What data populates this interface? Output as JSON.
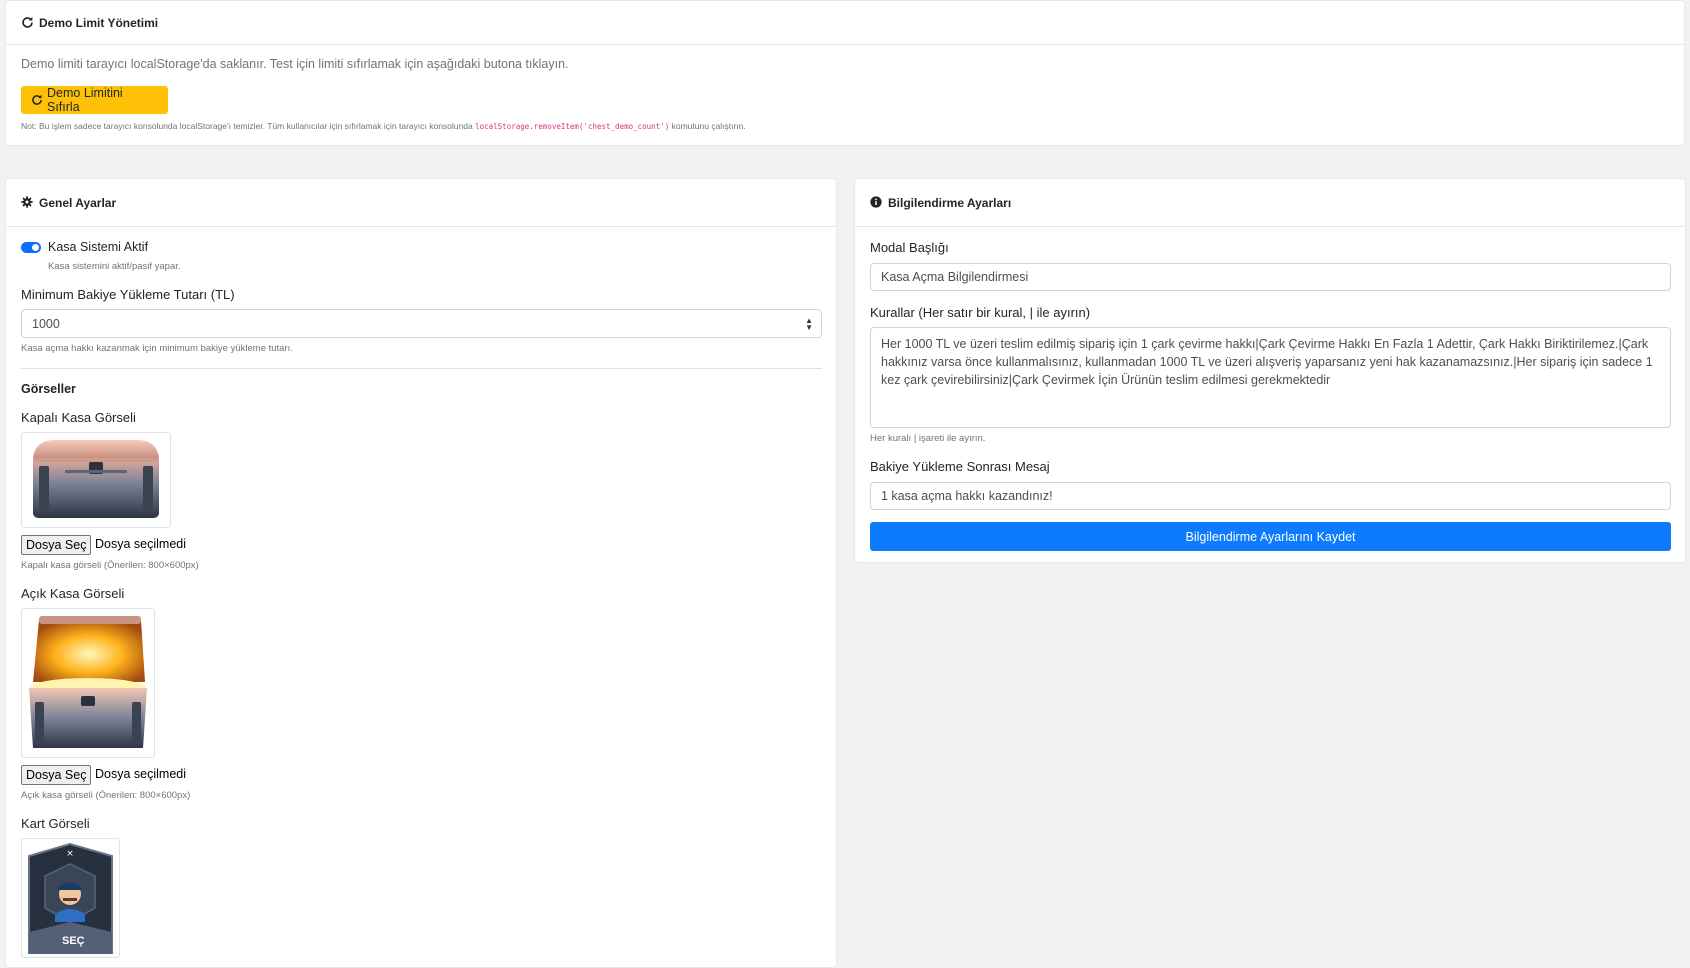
{
  "demo_card": {
    "title": "Demo Limit Yönetimi",
    "description": "Demo limiti tarayıcı localStorage'da saklanır. Test için limiti sıfırlamak için aşağıdaki butona tıklayın.",
    "reset_button": "Demo Limitini Sıfırla",
    "note_prefix": "Not: Bu işlem sadece tarayıcı konsolunda localStorage'ı temizler. Tüm kullanıcılar için sıfırlamak için tarayıcı konsolunda",
    "note_code": "localStorage.removeItem('chest_demo_count')",
    "note_suffix": "komutunu çalıştırın."
  },
  "general_card": {
    "title": "Genel Ayarlar",
    "toggle_label": "Kasa Sistemi Aktif",
    "toggle_on": true,
    "toggle_help": "Kasa sistemini aktif/pasif yapar.",
    "min_amount_label": "Minimum Bakiye Yükleme Tutarı (TL)",
    "min_amount_value": "1000",
    "min_amount_help": "Kasa açma hakkı kazanmak için minimum bakiye yükleme tutarı.",
    "images_heading": "Görseller",
    "closed_image_label": "Kapalı Kasa Görseli",
    "closed_image_help": "Kapalı kasa görseli (Önerilen: 800×600px)",
    "open_image_label": "Açık Kasa Görseli",
    "open_image_help": "Açık kasa görseli (Önerilen: 800×600px)",
    "card_image_label": "Kart Görseli",
    "card_image_text": "SEÇ",
    "file_button": "Dosya Seç",
    "file_status": "Dosya seçilmedi"
  },
  "info_card": {
    "title": "Bilgilendirme Ayarları",
    "modal_title_label": "Modal Başlığı",
    "modal_title_value": "Kasa Açma Bilgilendirmesi",
    "rules_label": "Kurallar (Her satır bir kural, | ile ayırın)",
    "rules_value": "Her 1000 TL ve üzeri teslim edilmiş sipariş için 1 çark çevirme hakkı|Çark Çevirme Hakkı En Fazla 1 Adettir, Çark Hakkı Biriktirilemez.|Çark hakkınız varsa önce kullanmalısınız, kullanmadan 1000 TL ve üzeri alışveriş yaparsanız yeni hak kazanamazsınız.|Her sipariş için sadece 1 kez çark çevirebilirsiniz|Çark Çevirmek İçin Ürünün teslim edilmesi gerekmektedir",
    "rules_help": "Her kuralı | işareti ile ayırın.",
    "after_message_label": "Bakiye Yükleme Sonrası Mesaj",
    "after_message_value": "1 kasa açma hakkı kazandınız!",
    "save_button": "Bilgilendirme Ayarlarını Kaydet"
  },
  "colors": {
    "primary": "#0d7bfd",
    "warning": "#ffc107",
    "background": "#f1f2f4"
  }
}
